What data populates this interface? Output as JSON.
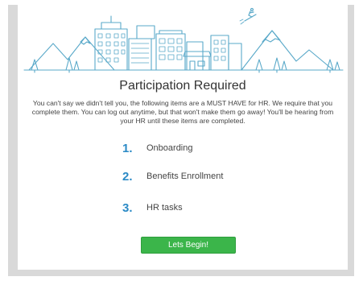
{
  "page": {
    "title": "Participation Required",
    "description": "You can't say we didn't tell you, the following items are a MUST HAVE for HR. We require that you complete them. You can log out anytime, but that won't make them go away! You'll be hearing from your HR until these items are completed."
  },
  "steps": [
    {
      "number": "1.",
      "label": "Onboarding"
    },
    {
      "number": "2.",
      "label": "Benefits Enrollment"
    },
    {
      "number": "3.",
      "label": "HR tasks"
    }
  ],
  "cta": {
    "label": "Lets Begin!"
  },
  "colors": {
    "accent": "#2b8ac6",
    "button": "#3bb54a",
    "line_art": "#5aa9c9"
  },
  "illustration": {
    "name": "city-mountains-illustration"
  }
}
